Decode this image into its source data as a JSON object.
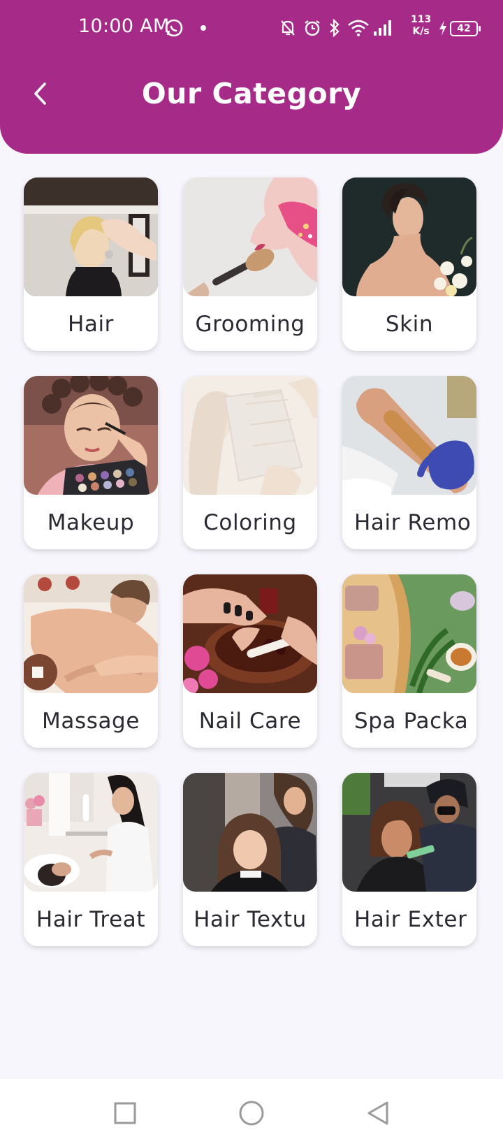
{
  "status_bar": {
    "time": "10:00 AM",
    "net_speed_value": "113",
    "net_speed_unit": "K/s",
    "battery": "42"
  },
  "header": {
    "title": "Our Category",
    "color": "#a62a87"
  },
  "categories": [
    {
      "label": "Hair",
      "image": "woman-blonde-hair-salon"
    },
    {
      "label": "Grooming",
      "image": "makeup-brush-face"
    },
    {
      "label": "Skin",
      "image": "woman-bare-shoulder-flowers"
    },
    {
      "label": "Makeup",
      "image": "woman-curlers-eyeshadow-palette"
    },
    {
      "label": "Coloring",
      "image": "hair-foil-coloring"
    },
    {
      "label": "Hair Remo",
      "image": "arm-waxing-gloved-hand"
    },
    {
      "label": "Massage",
      "image": "man-back-massage"
    },
    {
      "label": "Nail Care",
      "image": "hands-nail-file-bowl"
    },
    {
      "label": "Spa Packa",
      "image": "spa-soap-candle-tea"
    },
    {
      "label": "Hair Treat",
      "image": "hair-wash-salon"
    },
    {
      "label": "Hair Textu",
      "image": "stylist-hair-texture"
    },
    {
      "label": "Hair Exter",
      "image": "stylist-hair-extension"
    }
  ],
  "nav": {
    "recents": "square-icon",
    "home": "circle-icon",
    "back": "triangle-back-icon"
  }
}
